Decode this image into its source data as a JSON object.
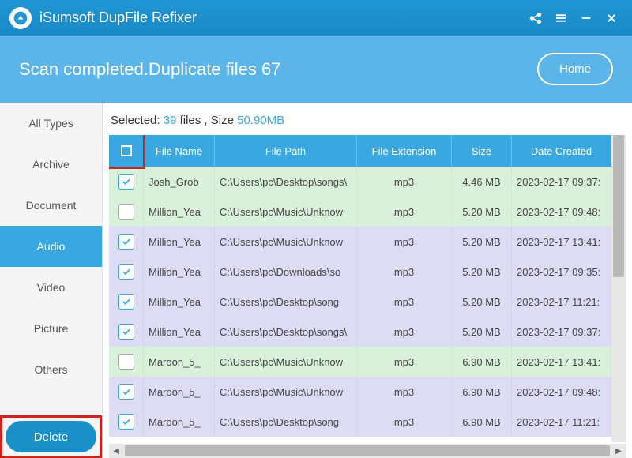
{
  "titlebar": {
    "app_name": "iSumsoft DupFile Refixer"
  },
  "status": {
    "text_prefix": "Scan completed.Duplicate files ",
    "count": "67",
    "home_label": "Home"
  },
  "sidebar": {
    "items": [
      {
        "label": "All Types",
        "active": false
      },
      {
        "label": "Archive",
        "active": false
      },
      {
        "label": "Document",
        "active": false
      },
      {
        "label": "Audio",
        "active": true
      },
      {
        "label": "Video",
        "active": false
      },
      {
        "label": "Picture",
        "active": false
      },
      {
        "label": "Others",
        "active": false
      }
    ],
    "delete_label": "Delete"
  },
  "selection": {
    "label_prefix": "Selected: ",
    "count": "39",
    "mid": " files ,  Size ",
    "size": "50.90MB"
  },
  "table": {
    "headers": {
      "name": "File Name",
      "path": "File Path",
      "ext": "File Extension",
      "size": "Size",
      "date": "Date Created"
    },
    "rows": [
      {
        "checked": true,
        "cls": "g",
        "name": "Josh_Grob",
        "path": "C:\\Users\\pc\\Desktop\\songs\\",
        "ext": "mp3",
        "size": "4.46 MB",
        "date": "2023-02-17 09:37:"
      },
      {
        "checked": false,
        "cls": "g",
        "name": "Million_Yea",
        "path": "C:\\Users\\pc\\Music\\Unknow",
        "ext": "mp3",
        "size": "5.20 MB",
        "date": "2023-02-17 09:48:"
      },
      {
        "checked": true,
        "cls": "p",
        "name": "Million_Yea",
        "path": "C:\\Users\\pc\\Music\\Unknow",
        "ext": "mp3",
        "size": "5.20 MB",
        "date": "2023-02-17 13:41:"
      },
      {
        "checked": true,
        "cls": "p",
        "name": "Million_Yea",
        "path": "C:\\Users\\pc\\Downloads\\so",
        "ext": "mp3",
        "size": "5.20 MB",
        "date": "2023-02-17 09:35:"
      },
      {
        "checked": true,
        "cls": "p",
        "name": "Million_Yea",
        "path": "C:\\Users\\pc\\Desktop\\song",
        "ext": "mp3",
        "size": "5.20 MB",
        "date": "2023-02-17 11:21:"
      },
      {
        "checked": true,
        "cls": "p",
        "name": "Million_Yea",
        "path": "C:\\Users\\pc\\Desktop\\songs\\",
        "ext": "mp3",
        "size": "5.20 MB",
        "date": "2023-02-17 09:37:"
      },
      {
        "checked": false,
        "cls": "g",
        "name": "Maroon_5_",
        "path": "C:\\Users\\pc\\Music\\Unknow",
        "ext": "mp3",
        "size": "6.90 MB",
        "date": "2023-02-17 13:41:"
      },
      {
        "checked": true,
        "cls": "p",
        "name": "Maroon_5_",
        "path": "C:\\Users\\pc\\Music\\Unknow",
        "ext": "mp3",
        "size": "6.90 MB",
        "date": "2023-02-17 09:48:"
      },
      {
        "checked": true,
        "cls": "p",
        "name": "Maroon_5_",
        "path": "C:\\Users\\pc\\Desktop\\song",
        "ext": "mp3",
        "size": "6.90 MB",
        "date": "2023-02-17 11:21:"
      }
    ]
  }
}
